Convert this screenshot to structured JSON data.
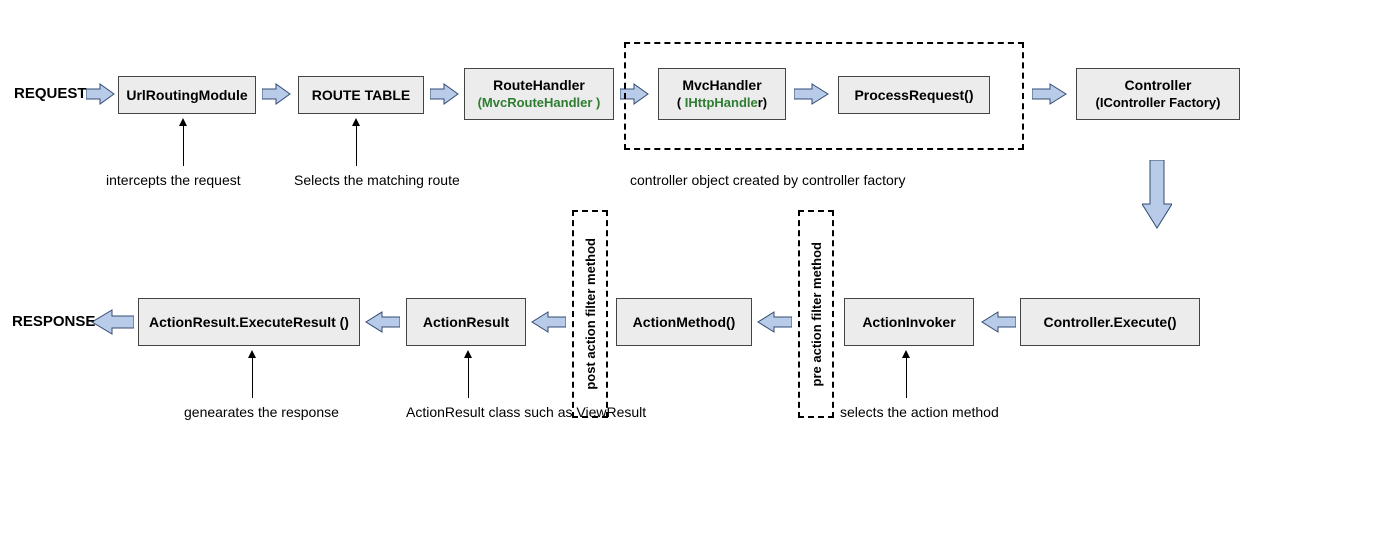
{
  "labels": {
    "request": "REQUEST",
    "response": "RESPONSE"
  },
  "top_row": {
    "url_routing": "UrlRoutingModule",
    "route_table": "ROUTE  TABLE",
    "route_handler_title": "RouteHandler",
    "route_handler_sub": "(MvcRouteHandler )",
    "mvc_handler_title": "MvcHandler",
    "mvc_handler_sub": "( IHttpHandler)",
    "process_request": "ProcessRequest()",
    "controller_title": "Controller",
    "controller_sub": "(IController Factory)"
  },
  "bottom_row": {
    "controller_execute": "Controller.Execute()",
    "action_invoker": "ActionInvoker",
    "action_method": "ActionMethod()",
    "action_result": "ActionResult",
    "execute_result": "ActionResult.ExecuteResult ()"
  },
  "dashed": {
    "pre_filter": "pre  action filter method",
    "post_filter": "post action filter method"
  },
  "captions": {
    "intercepts": "intercepts the request",
    "selects_route": "Selects the matching  route",
    "controller_factory": "controller object created by controller factory",
    "selects_action": "selects the action method",
    "actionresult_class": "ActionResult class such as ViewResult",
    "generates_response": "genearates the response"
  }
}
